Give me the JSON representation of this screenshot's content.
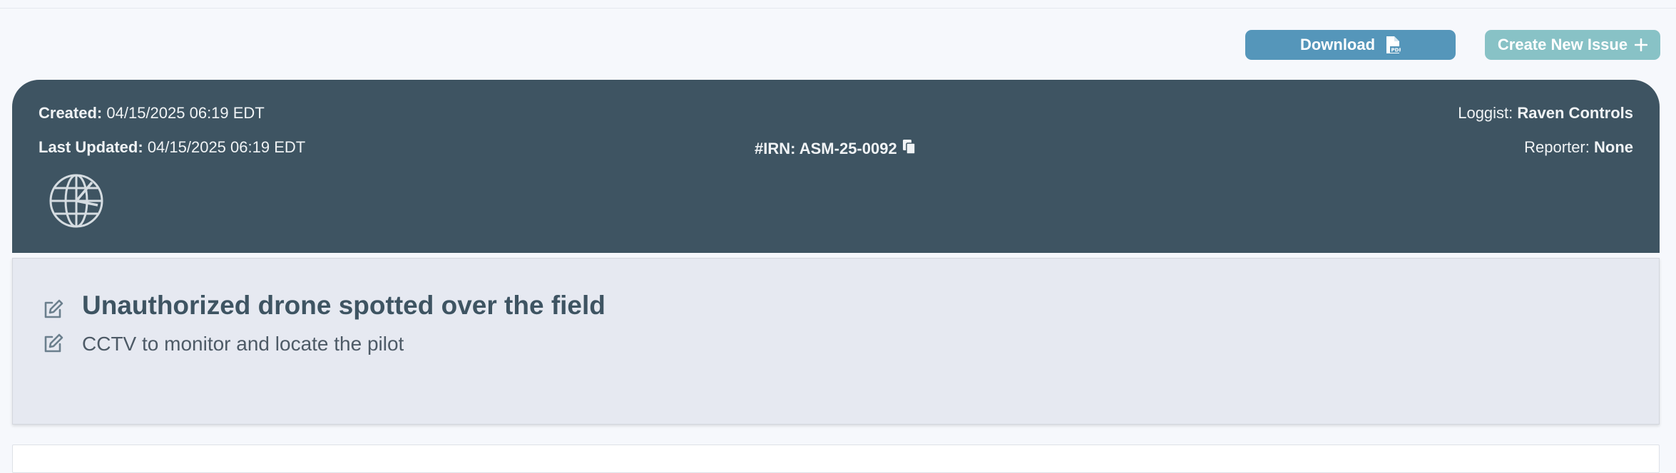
{
  "toolbar": {
    "download_label": "Download",
    "create_label": "Create New Issue"
  },
  "header": {
    "created_label": "Created:",
    "created_value": "04/15/2025 06:19 EDT",
    "updated_label": "Last Updated:",
    "updated_value": "04/15/2025 06:19 EDT",
    "irn_text": "#IRN: ASM-25-0092",
    "loggist_label": "Loggist:",
    "loggist_value": "Raven Controls",
    "reporter_label": "Reporter:",
    "reporter_value": "None"
  },
  "issue": {
    "title": "Unauthorized drone spotted over the field",
    "description": "CCTV to monitor and locate the pilot"
  },
  "icons": {
    "download": "pdf-file-icon",
    "create": "plus-icon",
    "copy": "copy-icon",
    "category": "globe-clock-icon",
    "edit": "edit-icon"
  },
  "colors": {
    "download_button": "#5596ba",
    "create_button": "#88c2c6",
    "header_bg": "#3e5462",
    "title_panel_bg": "#e6e9f1"
  }
}
